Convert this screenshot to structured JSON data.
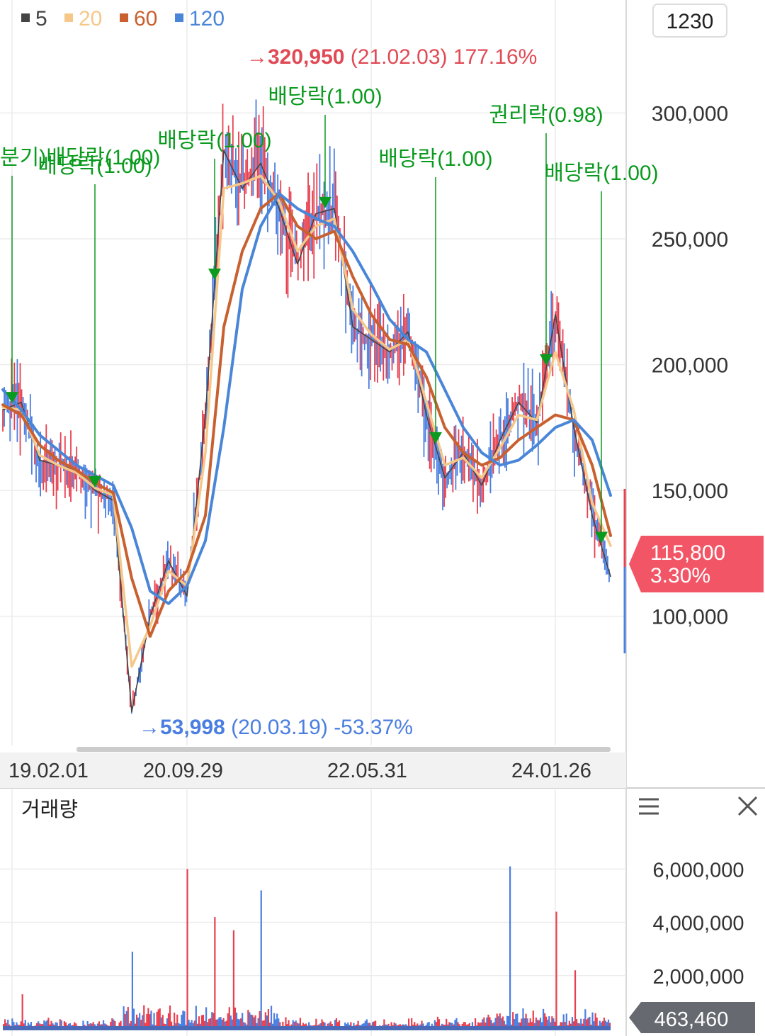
{
  "colors": {
    "ma5": "#444444",
    "ma20": "#f5c88a",
    "ma60": "#c8602f",
    "ma120": "#4a86d8",
    "up": "#e8404f",
    "down": "#4a7ee0",
    "event": "#0a9a1e",
    "high": "#e04a55",
    "low": "#4a7ee0"
  },
  "toolbar": {
    "interval": "1230",
    "menu_icon": "hamburger-menu-icon",
    "close_icon": "close-x-icon"
  },
  "chart_data": [
    {
      "type": "line",
      "panel": "price",
      "legend": [
        {
          "label": "5",
          "color": "#444444"
        },
        {
          "label": "20",
          "color": "#f5c88a"
        },
        {
          "label": "60",
          "color": "#c8602f"
        },
        {
          "label": "120",
          "color": "#4a86d8"
        }
      ],
      "x_ticks": [
        "19.02.01",
        "20.09.29",
        "22.05.31",
        "24.01.26"
      ],
      "y_ticks": [
        "300,000",
        "250,000",
        "200,000",
        "150,000",
        "100,000"
      ],
      "y_tick_values": [
        300000,
        250000,
        200000,
        150000,
        100000
      ],
      "ylim": [
        52000,
        328000
      ],
      "x": [
        "19.01",
        "19.03",
        "19.05",
        "19.07",
        "19.09",
        "19.11",
        "20.01",
        "20.03",
        "20.05",
        "20.07",
        "20.09",
        "20.11",
        "21.01",
        "21.03",
        "21.05",
        "21.07",
        "21.09",
        "21.11",
        "22.01",
        "22.03",
        "22.05",
        "22.07",
        "22.09",
        "22.11",
        "23.01",
        "23.03",
        "23.05",
        "23.07",
        "23.09",
        "23.11",
        "24.01",
        "24.03",
        "24.05",
        "24.07"
      ],
      "series": [
        {
          "name": "5",
          "values": [
            182000,
            185000,
            162000,
            160000,
            158000,
            150000,
            146000,
            62000,
            100000,
            122000,
            108000,
            180000,
            285000,
            270000,
            280000,
            262000,
            240000,
            260000,
            262000,
            215000,
            210000,
            205000,
            213000,
            180000,
            155000,
            165000,
            152000,
            170000,
            185000,
            177000,
            220000,
            175000,
            140000,
            115800
          ]
        },
        {
          "name": "20",
          "values": [
            183000,
            182000,
            164000,
            160000,
            157000,
            151000,
            148000,
            80000,
            96000,
            118000,
            112000,
            165000,
            270000,
            272000,
            275000,
            265000,
            245000,
            255000,
            258000,
            222000,
            212000,
            206000,
            210000,
            185000,
            160000,
            163000,
            155000,
            167000,
            180000,
            178000,
            205000,
            182000,
            145000,
            128000
          ]
        },
        {
          "name": "60",
          "values": [
            184000,
            180000,
            168000,
            162000,
            158000,
            153000,
            149000,
            115000,
            92000,
            110000,
            118000,
            140000,
            215000,
            245000,
            262000,
            268000,
            255000,
            250000,
            253000,
            235000,
            220000,
            210000,
            208000,
            195000,
            175000,
            165000,
            160000,
            163000,
            170000,
            175000,
            180000,
            178000,
            160000,
            132000
          ]
        },
        {
          "name": "120",
          "values": [
            190000,
            182000,
            172000,
            166000,
            160000,
            156000,
            152000,
            135000,
            110000,
            105000,
            112000,
            130000,
            175000,
            230000,
            255000,
            268000,
            262000,
            258000,
            255000,
            245000,
            232000,
            218000,
            210000,
            205000,
            190000,
            175000,
            165000,
            160000,
            162000,
            168000,
            175000,
            178000,
            170000,
            148000
          ]
        }
      ],
      "annotations": [
        {
          "text": "분기)배당락(1.00)",
          "date": "19.02"
        },
        {
          "text": "배당락(1.00)",
          "date": "19.11"
        },
        {
          "text": "배당락(1.00)",
          "date": "20.12"
        },
        {
          "text": "배당락(1.00)",
          "date": "21.12"
        },
        {
          "text": "배당락(1.00)",
          "date": "22.12"
        },
        {
          "text": "권리락(0.98)",
          "date": "23.12"
        },
        {
          "text": "배당락(1.00)",
          "date": "24.06"
        }
      ],
      "high_label": {
        "value": "320,950",
        "date": "(21.02.03)",
        "pct": "177.16%"
      },
      "low_label": {
        "value": "53,998",
        "date": "(20.03.19)",
        "pct": "-53.37%"
      },
      "current": {
        "price": "115,800",
        "change": "3.30%"
      }
    },
    {
      "type": "bar",
      "panel": "volume",
      "title": "거래량",
      "y_ticks": [
        "6,000,000",
        "4,000,000",
        "2,000,000"
      ],
      "y_tick_values": [
        6000000,
        4000000,
        2000000
      ],
      "ylim": [
        0,
        7500000
      ],
      "current_label": "463,460",
      "spikes": [
        {
          "x": "19.03",
          "value": 1300000
        },
        {
          "x": "20.03",
          "value": 2900000
        },
        {
          "x": "20.09",
          "value": 6000000
        },
        {
          "x": "20.12",
          "value": 4200000
        },
        {
          "x": "21.02",
          "value": 3700000
        },
        {
          "x": "21.05",
          "value": 5200000
        },
        {
          "x": "23.08",
          "value": 6100000
        },
        {
          "x": "24.01",
          "value": 4400000
        },
        {
          "x": "24.03",
          "value": 2200000
        }
      ]
    }
  ]
}
